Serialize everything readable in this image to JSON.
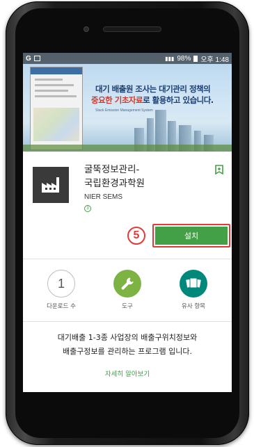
{
  "status_bar": {
    "battery": "98%",
    "time": "오후 1:48"
  },
  "banner": {
    "line1": "대기 배출원 조사는 대기관리 정책의",
    "line2_highlight": "중요한 기초자료",
    "line2_rest": "로 활용하고 있습니다.",
    "subtitle": "Stack Emission Management System"
  },
  "app": {
    "title_line1": "굴뚝정보관리-",
    "title_line2": "국립환경과학원",
    "developer": "NIER SEMS",
    "content_rating": "3",
    "install_label": "설치",
    "step_marker": "5"
  },
  "stats": [
    {
      "value": "1",
      "label": "다운로드 수",
      "icon": "download-count"
    },
    {
      "value": "",
      "label": "도구",
      "icon": "wrench-icon"
    },
    {
      "value": "",
      "label": "유사 항목",
      "icon": "similar-cards-icon"
    }
  ],
  "description": {
    "line1": "대기배출 1-3종 사업장의 배출구위치정보와",
    "line2": "배출구정보를 관리하는 프로그램 입니다.",
    "read_more": "자세히 알아보기"
  },
  "colors": {
    "accent": "#43a047",
    "highlight": "#e53935",
    "teal": "#00897b",
    "lime": "#7cb342"
  }
}
